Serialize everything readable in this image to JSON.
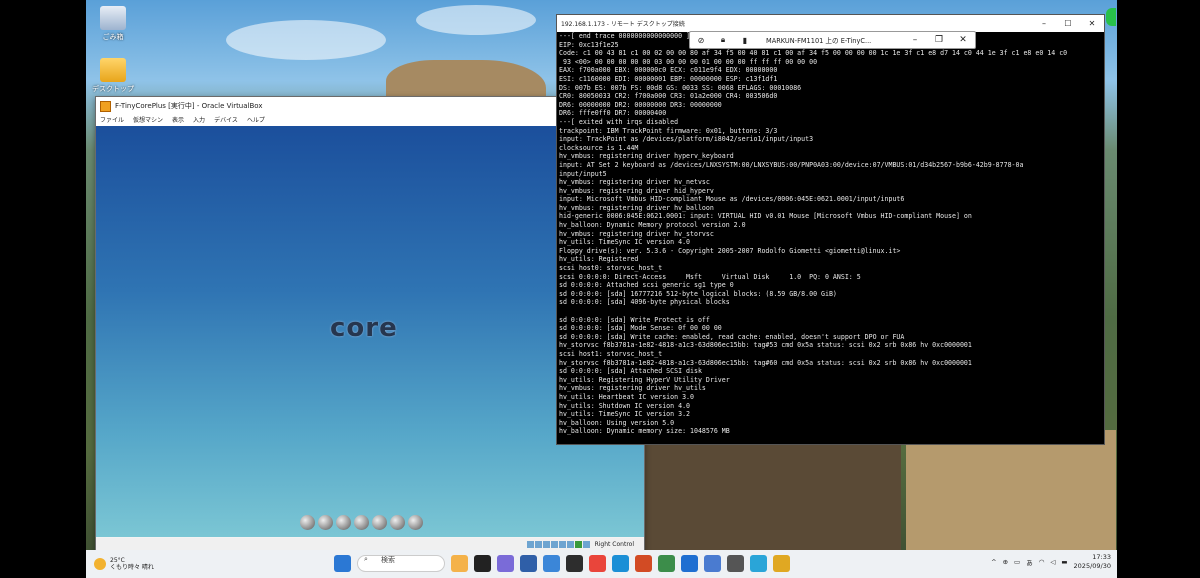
{
  "desktop": {
    "icons": [
      {
        "label": "ごみ箱",
        "icon": "recycle-bin-icon"
      },
      {
        "label": "デスクトップ",
        "icon": "folder-icon"
      }
    ]
  },
  "vbox": {
    "title": "F-TinyCorePlus [実行中] - Oracle VirtualBox",
    "menu": [
      "ファイル",
      "仮想マシン",
      "表示",
      "入力",
      "デバイス",
      "ヘルプ"
    ],
    "logo": "core",
    "status_right": "Right Control"
  },
  "rdp": {
    "title": "192.168.1.173 - リモート デスクトップ接続",
    "console_lines": [
      "---[ end trace 0000000000000000 ]---",
      "EIP: 0xc13f1e25",
      "Code: c1 00 43 81 c1 00 02 00 00 80 af 34 f5 00 40 81 c1 00 af 34 f5 00 00 00 00 1c 1e 3f c1 e8 d7 14 c0 44 1e 3f c1 e8 e0 14 c0",
      " 93 <00> 00 00 00 00 00 03 00 00 00 01 00 00 00 ff ff ff 00 00 00",
      "EAX: f700a000 EBX: 000000c0 ECX: c011e9f4 EDX: 00000000",
      "ESI: c1160000 EDI: 00000001 EBP: 00000000 ESP: c13f1df1",
      "DS: 007b ES: 007b FS: 00d8 GS: 0033 SS: 0068 EFLAGS: 00010086",
      "CR0: 80050033 CR2: f700a000 CR3: 01a2e000 CR4: 003506d0",
      "DR6: 00000000 DR2: 00000000 DR3: 00000000",
      "DR6: fffe0ff0 DR7: 00000400",
      "---[ exited with irqs disabled",
      "trackpoint: IBM TrackPoint firmware: 0x01, buttons: 3/3",
      "input: TrackPoint as /devices/platform/i8042/serio1/input/input3",
      "clocksource is 1.44M",
      "hv_vmbus: registering driver hyperv_keyboard",
      "input: AT Set 2 keyboard as /devices/LNXSYSTM:00/LNXSYBUS:00/PNP0A03:00/device:07/VMBUS:01/d34b2567-b9b6-42b9-8778-0a",
      "input/input5",
      "hv_vmbus: registering driver hv_netvsc",
      "hv_vmbus: registering driver hid_hyperv",
      "input: Microsoft Vmbus HID-compliant Mouse as /devices/0006:045E:0621.0001/input/input6",
      "hv_vmbus: registering driver hv_balloon",
      "hid-generic 0006:045E:0621.0001: input: VIRTUAL HID v0.01 Mouse [Microsoft Vmbus HID-compliant Mouse] on",
      "hv_balloon: Dynamic Memory protocol version 2.0",
      "hv_vmbus: registering driver hv_storvsc",
      "hv_utils: TimeSync IC version 4.0",
      "Floppy drive(s): ver. 5.3.6 - Copyright 2005-2007 Rodolfo Giometti <giometti@linux.it>",
      "hv_utils: Registered",
      "scsi host0: storvsc_host_t",
      "scsi 0:0:0:0: Direct-Access     Msft     Virtual Disk     1.0  PQ: 0 ANSI: 5",
      "sd 0:0:0:0: Attached scsi generic sg1 type 0",
      "sd 0:0:0:0: [sda] 16777216 512-byte logical blocks: (8.59 GB/8.00 GiB)",
      "sd 0:0:0:0: [sda] 4096-byte physical blocks",
      "",
      "sd 0:0:0:0: [sda] Write Protect is off",
      "sd 0:0:0:0: [sda] Mode Sense: 0f 00 00 00",
      "sd 0:0:0:0: [sda] Write cache: enabled, read cache: enabled, doesn't support DPO or FUA",
      "hv_storvsc f8b3781a-1e82-4818-a1c3-63d806ec15bb: tag#53 cmd 0x5a status: scsi 0x2 srb 0x86 hv 0xc0000001",
      "scsi host1: storvsc_host_t",
      "hv_storvsc f8b3781a-1e82-4818-a1c3-63d806ec15bb: tag#60 cmd 0x5a status: scsi 0x2 srb 0x86 hv 0xc0000001",
      "sd 0:0:0:0: [sda] Attached SCSI disk",
      "hv_utils: Registering HyperV Utility Driver",
      "hv_vmbus: registering driver hv_utils",
      "hv_utils: Heartbeat IC version 3.0",
      "hv_utils: Shutdown IC version 4.0",
      "hv_utils: TimeSync IC version 3.2",
      "hv_balloon: Using version 5.0",
      "hv_balloon: Dynamic memory size: 1048576 MB"
    ]
  },
  "rdp_bar": {
    "title": "MARKUN-FM1101 上の E-TinyC...",
    "icons": [
      "unpin-icon",
      "lock-icon",
      "signal-icon"
    ]
  },
  "taskbar": {
    "weather_temp": "25°C",
    "weather_desc": "くもり時々 晴れ",
    "search_placeholder": "検索",
    "clock_time": "17:33",
    "clock_date": "2025/09/30"
  }
}
